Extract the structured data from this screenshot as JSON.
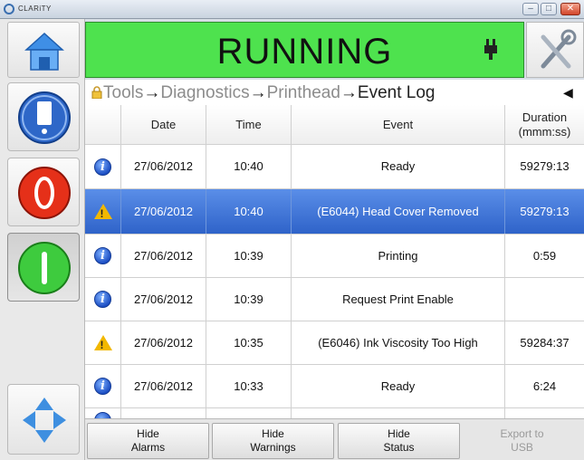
{
  "window": {
    "title": "CLARiTY"
  },
  "header": {
    "status": "RUNNING"
  },
  "breadcrumb": {
    "items": [
      "Tools",
      "Diagnostics",
      "Printhead"
    ],
    "current": "Event Log",
    "separator": "→"
  },
  "table": {
    "headers": {
      "date": "Date",
      "time": "Time",
      "event": "Event",
      "duration_line1": "Duration",
      "duration_line2": "(mmm:ss)"
    },
    "rows": [
      {
        "type": "info",
        "date": "27/06/2012",
        "time": "10:40",
        "event": "Ready",
        "duration": "59279:13"
      },
      {
        "type": "warning",
        "date": "27/06/2012",
        "time": "10:40",
        "event": "(E6044) Head Cover Removed",
        "duration": "59279:13"
      },
      {
        "type": "info",
        "date": "27/06/2012",
        "time": "10:39",
        "event": "Printing",
        "duration": "0:59"
      },
      {
        "type": "info",
        "date": "27/06/2012",
        "time": "10:39",
        "event": "Request Print Enable",
        "duration": ""
      },
      {
        "type": "warning",
        "date": "27/06/2012",
        "time": "10:35",
        "event": "(E6046) Ink Viscosity Too High",
        "duration": "59284:37"
      },
      {
        "type": "info",
        "date": "27/06/2012",
        "time": "10:33",
        "event": "Ready",
        "duration": "6:24"
      }
    ]
  },
  "bottom": {
    "hide_alarms_1": "Hide",
    "hide_alarms_2": "Alarms",
    "hide_warnings_1": "Hide",
    "hide_warnings_2": "Warnings",
    "hide_status_1": "Hide",
    "hide_status_2": "Status",
    "export_1": "Export to",
    "export_2": "USB"
  },
  "colors": {
    "status_green": "#4ee24e",
    "selection_blue": "#2f63c9",
    "warning_yellow": "#f2b800",
    "info_blue": "#1d4fc4"
  }
}
